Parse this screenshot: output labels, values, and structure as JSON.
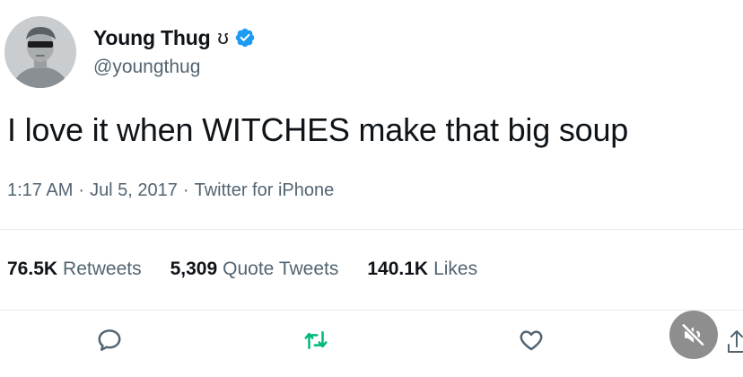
{
  "author": {
    "display_name": "Young Thug",
    "name_glyph": "ʊ",
    "handle": "@youngthug",
    "verified": true
  },
  "tweet": {
    "text": "I love it when WITCHES make that big soup",
    "time": "1:17 AM",
    "date": "Jul 5, 2017",
    "source": "Twitter for iPhone",
    "separator": "·"
  },
  "stats": {
    "retweets": {
      "count": "76.5K",
      "label": "Retweets"
    },
    "quotes": {
      "count": "5,309",
      "label": "Quote Tweets"
    },
    "likes": {
      "count": "140.1K",
      "label": "Likes"
    }
  },
  "actions": [
    "reply-icon",
    "retweet-icon",
    "like-icon",
    "share-icon"
  ],
  "overlay": {
    "icon": "mute-icon"
  },
  "colors": {
    "verified": "#1d9bf0",
    "retweet_icon": "#00ba7c",
    "secondary_text": "#536471",
    "primary_text": "#0f1419",
    "mute_bg": "#8e8e8e"
  }
}
